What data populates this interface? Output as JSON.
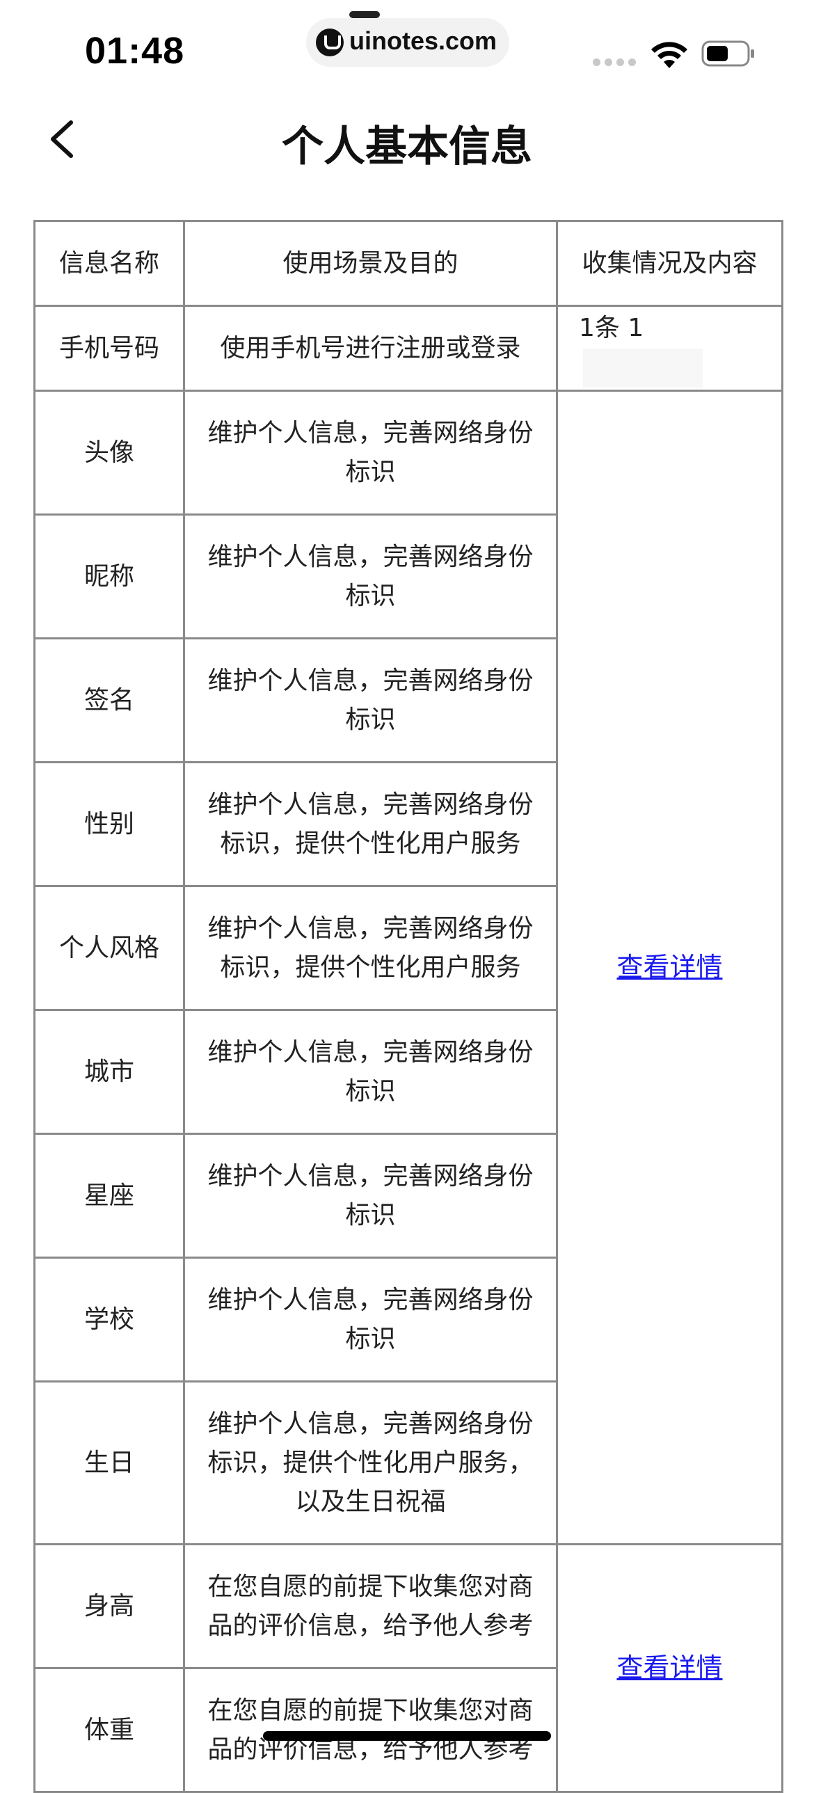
{
  "status_bar": {
    "time": "01:48",
    "url": "uinotes.com"
  },
  "nav": {
    "title": "个人基本信息"
  },
  "table": {
    "headers": [
      "信息名称",
      "使用场景及目的",
      "收集情况及内容"
    ],
    "phone_row": {
      "name": "手机号码",
      "purpose": "使用手机号进行注册或登录",
      "content": "1条 1"
    },
    "rows": [
      {
        "name": "头像",
        "purpose": "维护个人信息，完善网络身份标识"
      },
      {
        "name": "昵称",
        "purpose": "维护个人信息，完善网络身份标识"
      },
      {
        "name": "签名",
        "purpose": "维护个人信息，完善网络身份标识"
      },
      {
        "name": "性别",
        "purpose": "维护个人信息，完善网络身份标识，提供个性化用户服务"
      },
      {
        "name": "个人风格",
        "purpose": "维护个人信息，完善网络身份标识，提供个性化用户服务"
      },
      {
        "name": "城市",
        "purpose": "维护个人信息，完善网络身份标识"
      },
      {
        "name": "星座",
        "purpose": "维护个人信息，完善网络身份标识"
      },
      {
        "name": "学校",
        "purpose": "维护个人信息，完善网络身份标识"
      },
      {
        "name": "生日",
        "purpose": "维护个人信息，完善网络身份标识，提供个性化用户服务，以及生日祝福"
      }
    ],
    "group1_link": "查看详情",
    "rows2": [
      {
        "name": "身高",
        "purpose": "在您自愿的前提下收集您对商品的评价信息，给予他人参考"
      },
      {
        "name": "体重",
        "purpose": "在您自愿的前提下收集您对商品的评价信息，给予他人参考"
      }
    ],
    "group2_link": "查看详情"
  },
  "colors": {
    "link": "#1a1aee",
    "border": "#8a8a8a"
  }
}
